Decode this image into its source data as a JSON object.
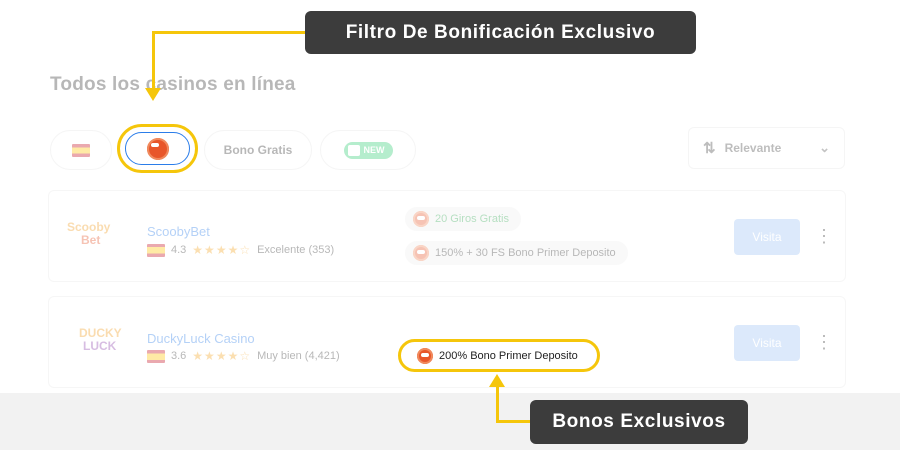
{
  "page": {
    "title": "Todos los casinos en línea"
  },
  "filters": {
    "bono_gratis": "Bono Gratis",
    "new_badge": "NEW"
  },
  "sort": {
    "label": "Relevante"
  },
  "casinos": [
    {
      "logo_line1": "Scooby",
      "logo_line2": "Bet",
      "name": "ScoobyBet",
      "rating": "4.3",
      "stars": "★★★★☆",
      "rating_text": "Excelente (353)",
      "bonuses": [
        "20 Giros Gratis",
        "150% + 30 FS Bono Primer Deposito"
      ],
      "visit": "Visita"
    },
    {
      "logo_line1": "DUCKY",
      "logo_line2": "LUCK",
      "name": "DuckyLuck Casino",
      "rating": "3.6",
      "stars": "★★★★☆",
      "rating_text": "Muy bien (4,421)",
      "bonuses": [
        "200% Bono Primer Deposito"
      ],
      "visit": "Visita"
    }
  ],
  "annotations": {
    "filter_callout": "Filtro De Bonificación Exclusivo",
    "bonus_callout": "Bonos Exclusivos"
  },
  "colors": {
    "highlight": "#f5c60b",
    "callout_bg": "#3c3c3c",
    "link": "#2b7de9",
    "button": "#9cc3f5"
  }
}
